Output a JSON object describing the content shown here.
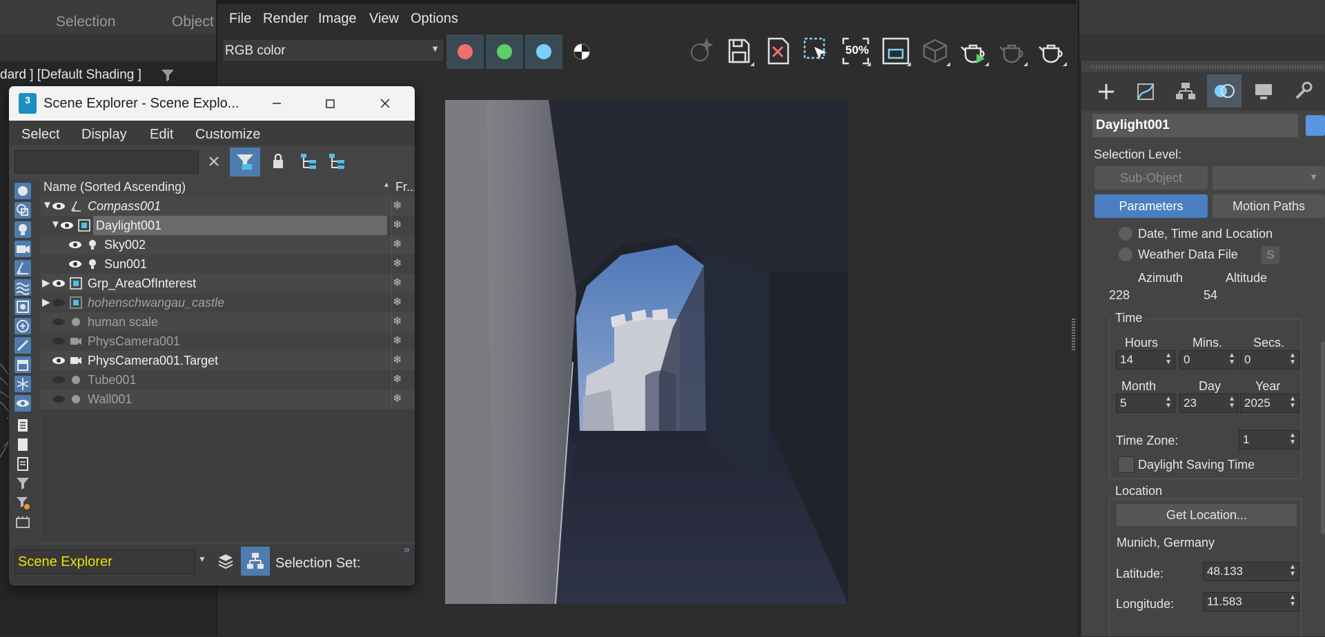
{
  "main_window": {
    "menu": [
      "Selection",
      "Object"
    ],
    "viewport_label": "dard ] [Default Shading ]"
  },
  "render_frame": {
    "menu": [
      "File",
      "Render",
      "Image",
      "View",
      "Options"
    ],
    "channel_select": "RGB color",
    "zoom_label": "50%",
    "channels": {
      "red": "#f07070",
      "green": "#5ccf66",
      "blue": "#7bd0ff"
    }
  },
  "scene_explorer": {
    "title": "Scene Explorer - Scene Explo...",
    "app_badge": "3",
    "menu": [
      "Select",
      "Display",
      "Edit",
      "Customize"
    ],
    "search_value": "",
    "column_name": "Name (Sorted Ascending)",
    "column_freeze": "Fr...",
    "rows": [
      {
        "name": "Compass001",
        "level": 0,
        "expanded": true,
        "visible": true,
        "style": "italic"
      },
      {
        "name": "Daylight001",
        "level": 1,
        "expanded": true,
        "visible": true,
        "style": "selected"
      },
      {
        "name": "Sky002",
        "level": 2,
        "visible": true,
        "style": "normal"
      },
      {
        "name": "Sun001",
        "level": 2,
        "visible": true,
        "style": "normal"
      },
      {
        "name": "Grp_AreaOfInterest",
        "level": 0,
        "expanded": false,
        "visible": true,
        "style": "normal"
      },
      {
        "name": "hohenschwangau_castle",
        "level": 0,
        "expanded": false,
        "visible": false,
        "style": "italic-dim"
      },
      {
        "name": "human scale",
        "level": 0,
        "visible": false,
        "style": "dim"
      },
      {
        "name": "PhysCamera001",
        "level": 0,
        "visible": false,
        "style": "dim"
      },
      {
        "name": "PhysCamera001.Target",
        "level": 0,
        "visible": true,
        "style": "normal"
      },
      {
        "name": "Tube001",
        "level": 0,
        "visible": false,
        "style": "dim"
      },
      {
        "name": "Wall001",
        "level": 0,
        "visible": false,
        "style": "dim"
      }
    ],
    "bottom_combo": "Scene Explorer",
    "selection_set_label": "Selection Set:",
    "expand_glyph": "»"
  },
  "command_panel": {
    "object_name": "Daylight001",
    "object_color": "#5a95e0",
    "selection_level_label": "Selection Level:",
    "sub_object_button": "Sub-Object",
    "parameters_tab": "Parameters",
    "motion_paths_tab": "Motion Paths",
    "radio_date": "Date, Time and Location",
    "radio_weather": "Weather Data File",
    "weather_btn": "S",
    "azimuth_label": "Azimuth",
    "azimuth_value": "228",
    "altitude_label": "Altitude",
    "altitude_value": "54",
    "time_group": "Time",
    "hours_label": "Hours",
    "hours": "14",
    "mins_label": "Mins.",
    "mins": "0",
    "secs_label": "Secs.",
    "secs": "0",
    "month_label": "Month",
    "month": "5",
    "day_label": "Day",
    "day": "23",
    "year_label": "Year",
    "year": "2025",
    "timezone_label": "Time Zone:",
    "timezone": "1",
    "dst_label": "Daylight Saving Time",
    "location_group": "Location",
    "get_location_button": "Get Location...",
    "location_name": "Munich, Germany",
    "latitude_label": "Latitude:",
    "latitude": "48.133",
    "longitude_label": "Longitude:",
    "longitude": "11.583"
  }
}
